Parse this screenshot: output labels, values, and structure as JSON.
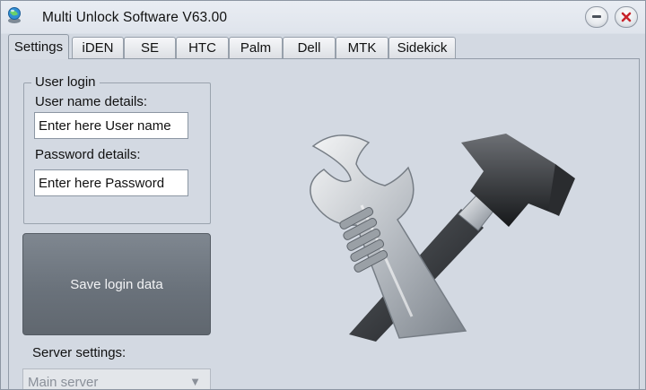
{
  "window": {
    "title": "Multi Unlock Software V63.00"
  },
  "tabs": [
    {
      "label": "Settings",
      "active": true
    },
    {
      "label": "iDEN",
      "active": false
    },
    {
      "label": "SE",
      "active": false
    },
    {
      "label": "HTC",
      "active": false
    },
    {
      "label": "Palm",
      "active": false
    },
    {
      "label": "Dell",
      "active": false
    },
    {
      "label": "MTK",
      "active": false
    },
    {
      "label": "Sidekick",
      "active": false
    }
  ],
  "user_login": {
    "group_title": "User login",
    "username_label": "User name details:",
    "username_value": "Enter here User name",
    "password_label": "Password details:",
    "password_value": "Enter here Password"
  },
  "save_button": {
    "label": "Save login data"
  },
  "server": {
    "label": "Server settings:",
    "selected": "Main server"
  },
  "icons": {
    "app": "app-globe-icon",
    "minimize": "minimize-icon",
    "close": "close-icon",
    "tools": "wrench-hammer-icon",
    "dropdown": "chevron-down-icon"
  },
  "colors": {
    "close_x": "#c8242b",
    "save_button_bg": "#6a727b"
  }
}
